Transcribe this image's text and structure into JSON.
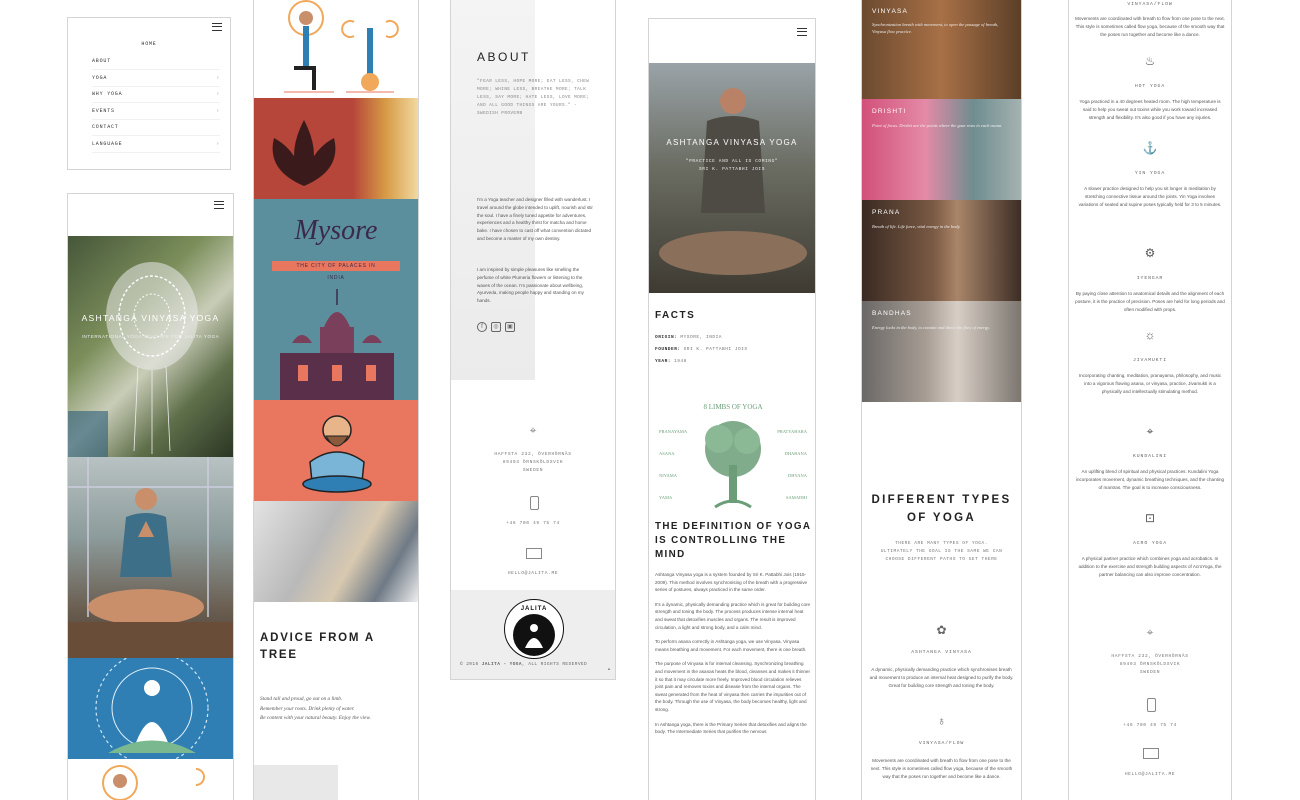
{
  "menu": {
    "home": "HOME",
    "items": [
      {
        "label": "ABOUT",
        "chevron": false
      },
      {
        "label": "YOGA",
        "chevron": true
      },
      {
        "label": "WHY YOGA",
        "chevron": true
      },
      {
        "label": "EVENTS",
        "chevron": true
      },
      {
        "label": "CONTACT",
        "chevron": false
      },
      {
        "label": "LANGUAGE",
        "chevron": true
      }
    ],
    "chevron_glyph": "›"
  },
  "home": {
    "hero_title": "ASHTANGA VINYASA YOGA",
    "hero_sub": "INTERNATIONAL YOGA TEACHER FOR JALITA YOGA"
  },
  "illustrations": {
    "mysore_title": "Mysore",
    "mysore_banner": "THE CITY OF PALACES IN",
    "mysore_sub": "INDIA",
    "advice_title": "ADVICE FROM A TREE",
    "advice_lines": [
      "Stand tall and proud, go out on a limb.",
      "Remember your roots. Drink plenty of water.",
      "Be content with your natural beauty. Enjoy the view."
    ]
  },
  "about": {
    "heading": "ABOUT",
    "quote": "\"FEAR LESS, HOPE MORE; EAT LESS, CHEW MORE; WHINE LESS, BREATHE MORE; TALK LESS, SAY MORE; HATE LESS, LOVE MORE; AND ALL GOOD THINGS ARE YOURS.\" - SWEDISH PROVERB",
    "para1": "I'm a Yoga teacher and designer filled with wanderlust. I travel around the globe intended to uplift, nourish and stir the soul. I have a finely tuned appetite for adventures, experiences and a healthy thirst for matcha and home bake. I have chosen to cast off what convention dictated and become a master of my own destiny.",
    "para2": "I am inspired by simple pleasures like smelling the perfume of white Plumeria flowers or listening to the waves of the ocean. I'm passionate about wellbeing, Ayurveda, making people happy and standing on my hands.",
    "address": [
      "HAFFSTA 232, ÖVERHÖRNÄS",
      "89493 ÖRNSKÖLDSVIK",
      "SWEDEN"
    ],
    "phone": "+46 700 49 75 74",
    "email": "HELLO@JALITA.ME",
    "logo_text": "JALITA",
    "copyright_prefix": "© 2016 ",
    "copyright_brand": "JALITA - YOGA",
    "copyright_suffix": ", ALL RIGHTS RESERVED",
    "back_to_top": "▲"
  },
  "ashtanga": {
    "hero_title": "ASHTANGA VINYASA YOGA",
    "hero_quote": "\"PRACTICE AND ALL IS COMING\"",
    "hero_author": "SRI K. PATTABHI JOIS",
    "facts_heading": "FACTS",
    "facts": [
      {
        "label": "ORIGIN:",
        "value": "MYSORE, INDIA"
      },
      {
        "label": "FOUNDER:",
        "value": "SRI K. PATTABHI JOIS"
      },
      {
        "label": "YEAR:",
        "value": "1948"
      }
    ],
    "limbs_title": "8 LIMBS OF YOGA",
    "limbs_left": [
      "PRANAYAMA",
      "ASANA",
      "NIYAMA",
      "YAMA"
    ],
    "limbs_right": [
      "PRATYAHARA",
      "DHARANA",
      "DHYANA",
      "SAMADHI"
    ],
    "definition_heading": "THE DEFINITION OF YOGA IS CONTROLLING THE MIND",
    "paras": [
      "Ashtanga Vinyasa yoga is a system founded by Sri K. Pattabhi Jois (1915-2009). This method involves synchronising of the breath with a progressive series of postures, always practiced in the same order.",
      "It's a dynamic, physically demanding practice which is great for building core strength and toning the body. The process produces intense internal heat and sweat that detoxifies muscles and organs. The result is improved circulation, a light and strong body, and a calm mind.",
      "To perform asana correctly in Ashtanga yoga, we use Vinyasa. Vinyasa means breathing and movement. For each movement, there is one breath.",
      "The purpose of Vinyasa is for internal cleansing. Synchronizing breathing and movement in the asanas heats the blood, cleanses and makes it thinner it so that it may circulate more freely. Improved blood circulation relieves joint pain and removes toxins and disease from the internal organs. The sweat generated from the heat of vinyasa then carries the impurities out of the body. Through the use of Vinyasa, the body becomes healthy, light and strong.",
      "In Ashtanga yoga, there is the Primary Series that detoxifies and aligns the body. The Intermediate Series that purifies the nervous"
    ]
  },
  "styles": {
    "blocks": [
      {
        "label": "VINYASA",
        "desc": "Synchronization breath with movement, to open the passage of breath, Vinyasa flow practice."
      },
      {
        "label": "DRISHTI",
        "desc": "Point of focus. Drishti are the points where the gaze rests in each asana."
      },
      {
        "label": "PRANA",
        "desc": "Breath of life. Life force, vital energy in the body."
      },
      {
        "label": "BANDHAS",
        "desc": "Energy locks in the body, to contain and direct the flow of energy."
      }
    ],
    "heading": "DIFFERENT TYPES OF YOGA",
    "intro": "THERE ARE MANY TYPES OF YOGA. ULTIMATELY THE GOAL IS THE SAME WE CAN CHOOSE DIFFERENT PATHS TO GET THERE",
    "ashtanga_title": "ASHTANGA VINYASA",
    "ashtanga_desc": "A dynamic, physically demanding practice which synchronises breath and movement to produce an internal heat designed to purify the body. Great for building core strength and toning the body.",
    "flow_title": "VINYASA/FLOW",
    "flow_desc": "Movements are coordinated with breath to flow from one pose to the next. This style is sometimes called flow yoga, because of the smooth way that the poses run together and become like a dance."
  },
  "types": {
    "top_title": "VINYASA/FLOW",
    "top_desc": "Movements are coordinated with breath to flow from one pose to the next. This style is sometimes called flow yoga, because of the smooth way that the poses run together and become like a dance.",
    "items": [
      {
        "icon": "lightbulb-icon",
        "glyph": "♨",
        "title": "HOT YOGA",
        "desc": "Yoga practiced in a 40 degrees heated room. The high temperature is said to help you sweat out toxins while you work toward increased strength and flexibility. It's also good if you have any injuries."
      },
      {
        "icon": "anchor-icon",
        "glyph": "⚓",
        "title": "YIN YOGA",
        "desc": "A slower practice designed to help you sit longer in meditation by stretching connective tissue around the joints. Yin Yoga involves variations of seated and supine poses typically held for 3 to 5 minutes."
      },
      {
        "icon": "gears-icon",
        "glyph": "⚙",
        "title": "IYENGAR",
        "desc": "By paying close attention to anatomical details and the alignment of each posture, it is the practice of precision. Poses are held for long periods and often modified with props."
      },
      {
        "icon": "lightbulb-icon",
        "glyph": "☼",
        "title": "JIVAMUKTI",
        "desc": "Incorporating chanting, meditation, pranayama, philosophy, and music into a vigorous flowing asana, or vinyasa, practice, Jivamukti is a physically and intellectually stimulating method."
      },
      {
        "icon": "telescope-icon",
        "glyph": "⌖",
        "title": "KUNDALINI",
        "desc": "An uplifting blend of spiritual and physical practices. Kundalini Yoga incorporates movement, dynamic breathing techniques, and the chanting of mantras. The goal is to increase consciousness."
      },
      {
        "icon": "focus-icon",
        "glyph": "⊡",
        "title": "ACRO YOGA",
        "desc": "A physical partner practice which combines yoga and acrobatics. In addition to the exercise and strength building aspects of AcroYoga, the partner balancing can also improve concentration."
      }
    ],
    "address": [
      "HAFFSTA 232, ÖVERHÖRNÄS",
      "89493 ÖRNSKÖLDSVIK",
      "SWEDEN"
    ],
    "phone": "+46 700 49 75 74",
    "email": "HELLO@JALITA.ME"
  },
  "colors": {
    "accent_orange": "#e9765f",
    "teal": "#5c8f9d",
    "tree_green": "#6b9e78",
    "blue": "#2f7fb5",
    "rust": "#b6453a"
  }
}
